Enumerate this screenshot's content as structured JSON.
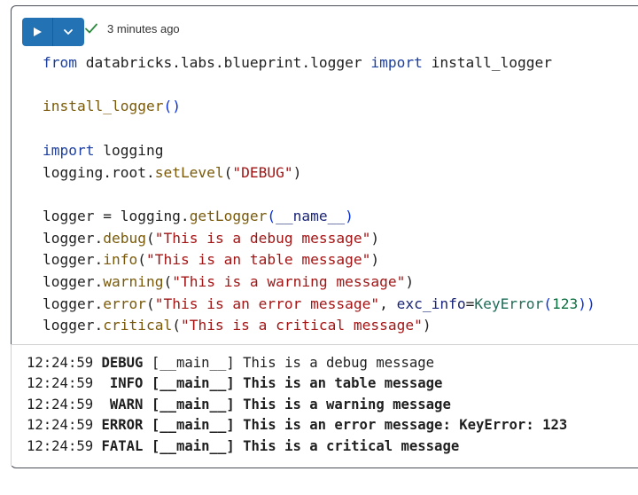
{
  "toolbar": {
    "run_icon": "play-icon",
    "dropdown_icon": "chevron-down-icon",
    "status_icon": "check-icon",
    "status_text": "3 minutes ago",
    "colors": {
      "run_button": "#2272b4",
      "check": "#2b8a3e"
    }
  },
  "code": {
    "l1": {
      "from": "from",
      "module": " databricks.labs.blueprint.logger ",
      "import": "import",
      "name": " install_logger"
    },
    "l3": {
      "fn": "install_logger",
      "parens": "()"
    },
    "l5": {
      "import": "import",
      "module": " logging"
    },
    "l6": {
      "obj": "logging.root.",
      "fn": "setLevel",
      "open": "(",
      "arg": "\"DEBUG\"",
      "close": ")"
    },
    "l8": {
      "lhs": "logger = logging.",
      "fn": "getLogger",
      "open": "(",
      "arg": "__name__",
      "close": ")"
    },
    "l9": {
      "obj": "logger.",
      "fn": "debug",
      "open": "(",
      "arg": "\"This is a debug message\"",
      "close": ")"
    },
    "l10": {
      "obj": "logger.",
      "fn": "info",
      "open": "(",
      "arg": "\"This is an table message\"",
      "close": ")"
    },
    "l11": {
      "obj": "logger.",
      "fn": "warning",
      "open": "(",
      "arg": "\"This is a warning message\"",
      "close": ")"
    },
    "l12": {
      "obj": "logger.",
      "fn": "error",
      "open": "(",
      "arg": "\"This is an error message\"",
      "comma": ", ",
      "param": "exc_info",
      "eq": "=",
      "cls": "KeyError",
      "open2": "(",
      "num": "123",
      "close2": "))"
    },
    "l13": {
      "obj": "logger.",
      "fn": "critical",
      "open": "(",
      "arg": "\"This is a critical message\"",
      "close": ")"
    }
  },
  "output": {
    "lines": [
      {
        "time": "12:24:59 ",
        "level": "DEBUG",
        "module": " [__main__] ",
        "message": "This is a debug message"
      },
      {
        "time": "12:24:59  ",
        "level": "INFO",
        "module": " [__main__] ",
        "message": "This is an table message"
      },
      {
        "time": "12:24:59  ",
        "level": "WARN",
        "module": " [__main__] ",
        "message": "This is a warning message"
      },
      {
        "time": "12:24:59 ",
        "level": "ERROR",
        "module": " [__main__] ",
        "message": "This is an error message: KeyError: 123"
      },
      {
        "time": "12:24:59 ",
        "level": "FATAL",
        "module": " [__main__] ",
        "message": "This is a critical message"
      }
    ]
  }
}
